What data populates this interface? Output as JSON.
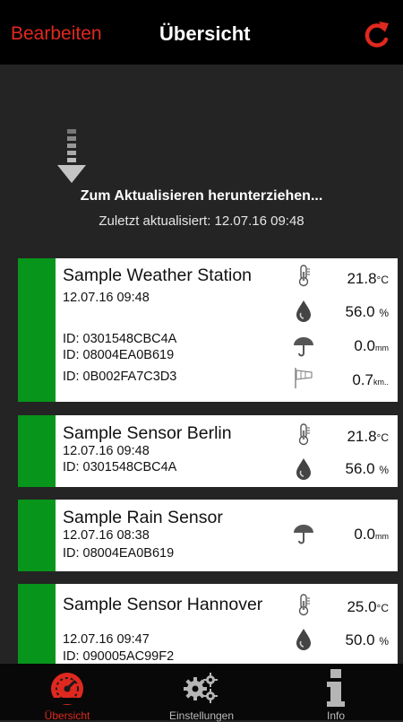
{
  "nav": {
    "edit_label": "Bearbeiten",
    "title": "Übersicht",
    "refresh_icon": "refresh-icon"
  },
  "pull": {
    "title": "Zum Aktualisieren herunterziehen...",
    "subtitle": "Zuletzt aktualisiert: 12.07.16   09:48"
  },
  "stations": [
    {
      "name": "Sample Weather Station",
      "timestamp": "12.07.16   09:48",
      "ids": [
        "ID: 0301548CBC4A",
        "ID: 08004EA0B619",
        "ID: 0B002FA7C3D3"
      ],
      "temperature": "21.8",
      "temperature_unit": "°C",
      "humidity": "56.0",
      "humidity_unit": "%",
      "rain": "0.0",
      "rain_unit": "mm",
      "wind": "0.7",
      "wind_unit": "km.."
    },
    {
      "name": "Sample Sensor Berlin",
      "timestamp": "12.07.16   09:48",
      "ids": [
        "ID: 0301548CBC4A"
      ],
      "temperature": "21.8",
      "temperature_unit": "°C",
      "humidity": "56.0",
      "humidity_unit": "%"
    },
    {
      "name": "Sample Rain Sensor",
      "timestamp": "12.07.16   08:38",
      "ids": [
        "ID: 08004EA0B619"
      ],
      "rain": "0.0",
      "rain_unit": "mm"
    },
    {
      "name": "Sample Sensor Hannover",
      "timestamp": "12.07.16   09:47",
      "ids": [
        "ID: 090005AC99F2"
      ],
      "temperature": "25.0",
      "temperature_unit": "°C",
      "humidity": "50.0",
      "humidity_unit": "%"
    }
  ],
  "tabs": [
    {
      "label": "Übersicht",
      "icon": "gauge-icon",
      "active": true
    },
    {
      "label": "Einstellungen",
      "icon": "gears-icon",
      "active": false
    },
    {
      "label": "Info",
      "icon": "info-icon",
      "active": false
    }
  ],
  "colors": {
    "accent": "#e0281f",
    "status_ok": "#07951b",
    "background": "#242424",
    "bar": "#000000"
  }
}
